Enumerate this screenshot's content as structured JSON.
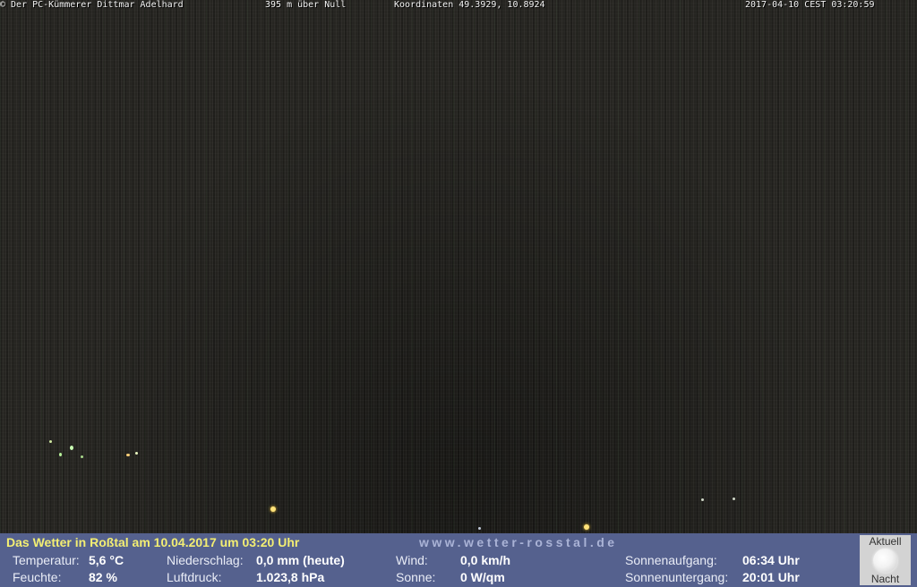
{
  "overlay": {
    "copyright": "© Der PC-Kümmerer Dittmar Adelhard",
    "altitude": "395 m über Null",
    "coordinates": "Koordinaten 49.3929, 10.8924",
    "datetime": "2017-04-10 CEST 03:20:59"
  },
  "weather": {
    "title": "Das Wetter in Roßtal am 10.04.2017 um 03:20 Uhr",
    "website": "www.wetter-rosstal.de",
    "temperature": {
      "label": "Temperatur:",
      "value": "5,6 °C"
    },
    "humidity": {
      "label": "Feuchte:",
      "value": "82 %"
    },
    "precipitation": {
      "label": "Niederschlag:",
      "value": "0,0 mm (heute)"
    },
    "pressure": {
      "label": "Luftdruck:",
      "value": "1.023,8 hPa"
    },
    "wind": {
      "label": "Wind:",
      "value": "0,0 km/h"
    },
    "sun": {
      "label": "Sonne:",
      "value": "0 W/qm"
    },
    "sunrise": {
      "label": "Sonnenaufgang:",
      "value": "06:34 Uhr"
    },
    "sunset": {
      "label": "Sonnenuntergang:",
      "value": "20:01 Uhr"
    }
  },
  "moon": {
    "top_label": "Aktuell",
    "bottom_label": "Nacht",
    "icon": "full-moon-icon"
  },
  "colors": {
    "overlay_text": "#f2dc2e",
    "weather_bar": "#55618e",
    "weather_title": "#f3ee73"
  }
}
